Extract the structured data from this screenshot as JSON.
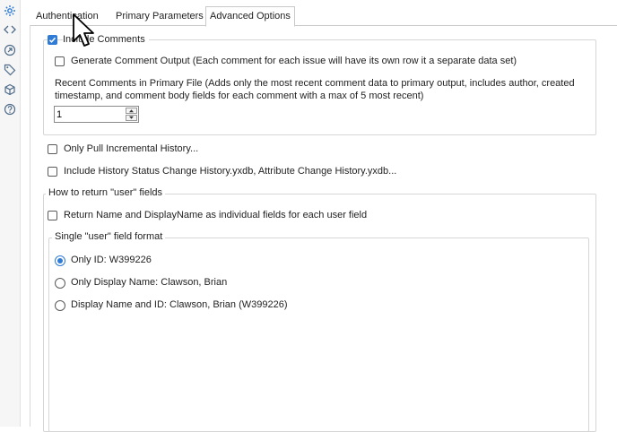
{
  "rail": {
    "icons": [
      "gear-icon",
      "code-icon",
      "arrow-circle-icon",
      "tag-icon",
      "cube-icon",
      "help-icon"
    ]
  },
  "tabs": [
    {
      "label": "Authentication",
      "active": false
    },
    {
      "label": "Primary Parameters",
      "active": false
    },
    {
      "label": "Advanced Options",
      "active": true
    }
  ],
  "comments": {
    "include_label": "Include Comments",
    "include_checked": true,
    "generate_output_label": "Generate Comment Output (Each comment for each issue will have its own row it a separate data set)",
    "generate_output_checked": false,
    "recent_description": "Recent Comments in Primary File (Adds only the most recent comment data to primary output, includes author, created timestamp, and comment body fields for each comment with a max of 5 most recent)",
    "recent_value": "1"
  },
  "options": {
    "incremental_label": "Only Pull Incremental History...",
    "history_label": "Include History Status Change History.yxdb, Attribute Change History.yxdb..."
  },
  "user_fields": {
    "group_title": "How to return \"user\" fields",
    "individual_label": "Return Name and DisplayName as individual fields for each user field",
    "format_group_title": "Single \"user\" field format",
    "formats": [
      {
        "label": "Only ID: W399226",
        "selected": true
      },
      {
        "label": "Only Display Name: Clawson, Brian",
        "selected": false
      },
      {
        "label": "Display Name and ID: Clawson, Brian (W399226)",
        "selected": false
      }
    ]
  },
  "colors": {
    "accent": "#2f7bd6",
    "border": "#d6d6d6"
  }
}
